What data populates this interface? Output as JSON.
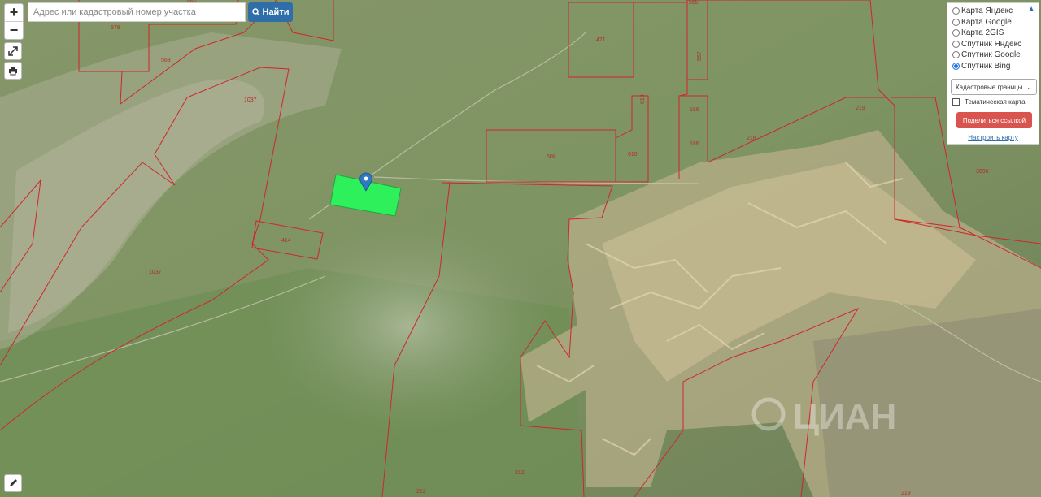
{
  "search": {
    "placeholder": "Адрес или кадастровый номер участка",
    "button_label": "Найти"
  },
  "controls": {
    "zoom_in": "+",
    "zoom_out": "−"
  },
  "layers": {
    "options": [
      "Карта Яндекс",
      "Карта Google",
      "Карта 2GIS",
      "Спутник Яндекс",
      "Спутник Google",
      "Спутник Bing"
    ],
    "selected": "Спутник Bing",
    "select_value": "Кадастровые границы",
    "thematic_label": "Тематическая карта",
    "share_label": "Поделиться ссылкой",
    "configure_label": "Настроить карту"
  },
  "parcel_labels": [
    "567",
    "578",
    "568",
    "1037",
    "565",
    "471",
    "567",
    "186",
    "186",
    "610",
    "610",
    "608",
    "219",
    "218",
    "3096",
    "414",
    "1037",
    "212",
    "212",
    "219"
  ],
  "watermark": "ЦИАН",
  "colors": {
    "boundary": "#d0262b",
    "selected_parcel": "#2ef05a",
    "button_blue": "#2f6ea8",
    "share_red": "#d9534f"
  }
}
